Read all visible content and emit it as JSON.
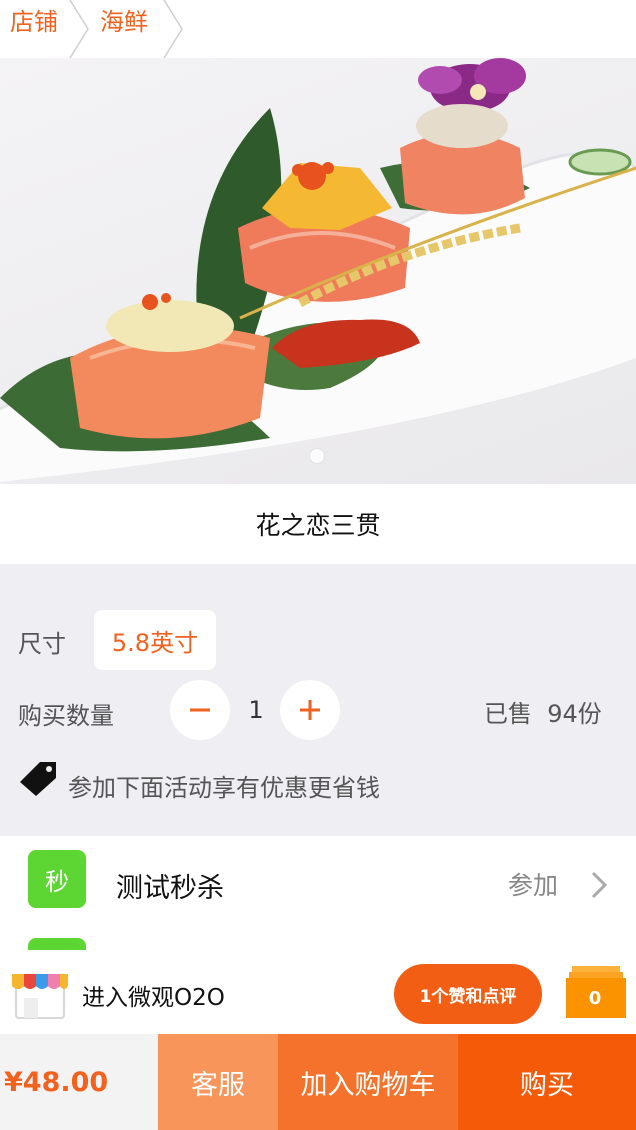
{
  "breadcrumb": {
    "items": [
      "店铺",
      "海鲜"
    ]
  },
  "product": {
    "name": "花之恋三贯"
  },
  "options": {
    "size_label": "尺寸",
    "size_value": "5.8英寸",
    "qty_label": "购买数量",
    "qty_value": "1",
    "sold_label": "已售",
    "sold_value": "94份",
    "promo_text": "参加下面活动享有优惠更省钱"
  },
  "activities": [
    {
      "badge": "秒",
      "name": "测试秒杀",
      "action": "参加"
    }
  ],
  "o2o": {
    "text": "进入微观O2O",
    "like_button": "1个赞和点评",
    "cart_count": "0"
  },
  "bottom_bar": {
    "price": "¥48.00",
    "service": "客服",
    "add_to_cart": "加入购物车",
    "buy": "购买"
  },
  "colors": {
    "accent": "#f2611d",
    "badge_green": "#5dd633",
    "service_bg": "#f7955a",
    "cart_bg": "#f4722c",
    "buy_bg": "#f45a08"
  },
  "icons": [
    "chevron-separator-icon",
    "minus-icon",
    "plus-icon",
    "tag-icon",
    "chevron-right-icon",
    "shop-awning-icon",
    "cart-stack-icon"
  ]
}
